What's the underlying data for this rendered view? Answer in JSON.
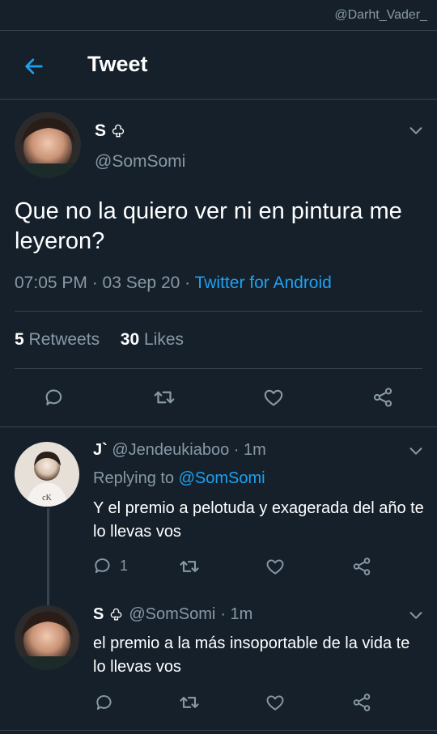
{
  "watermark": "@Darht_Vader_",
  "header": {
    "title": "Tweet"
  },
  "main_tweet": {
    "display_name": "S",
    "handle": "@SomSomi",
    "text": "Que no la quiero ver ni en pintura me leyeron?",
    "timestamp": "07:05 PM · 03 Sep 20 · ",
    "source": "Twitter for Android",
    "retweets_count": "5",
    "retweets_label": "Retweets",
    "likes_count": "30",
    "likes_label": "Likes"
  },
  "reply_1": {
    "display_name": "J`",
    "handle": "@Jendeukiaboo",
    "time": "· 1m",
    "replying_prefix": "Replying to ",
    "replying_to": "@SomSomi",
    "text": "Y el premio a pelotuda y exagerada del año te lo llevas vos",
    "reply_count": "1"
  },
  "reply_2": {
    "display_name": "S",
    "handle": "@SomSomi",
    "time": "· 1m",
    "text": "el premio a la más insoportable de la vida te lo llevas vos"
  },
  "colors": {
    "background": "#15202b",
    "accent": "#1da1f2",
    "muted": "#8899a6",
    "divider": "#38444d"
  },
  "icons": [
    "back-arrow-icon",
    "club-icon",
    "chevron-down-icon",
    "reply-icon",
    "retweet-icon",
    "like-icon",
    "share-icon"
  ]
}
